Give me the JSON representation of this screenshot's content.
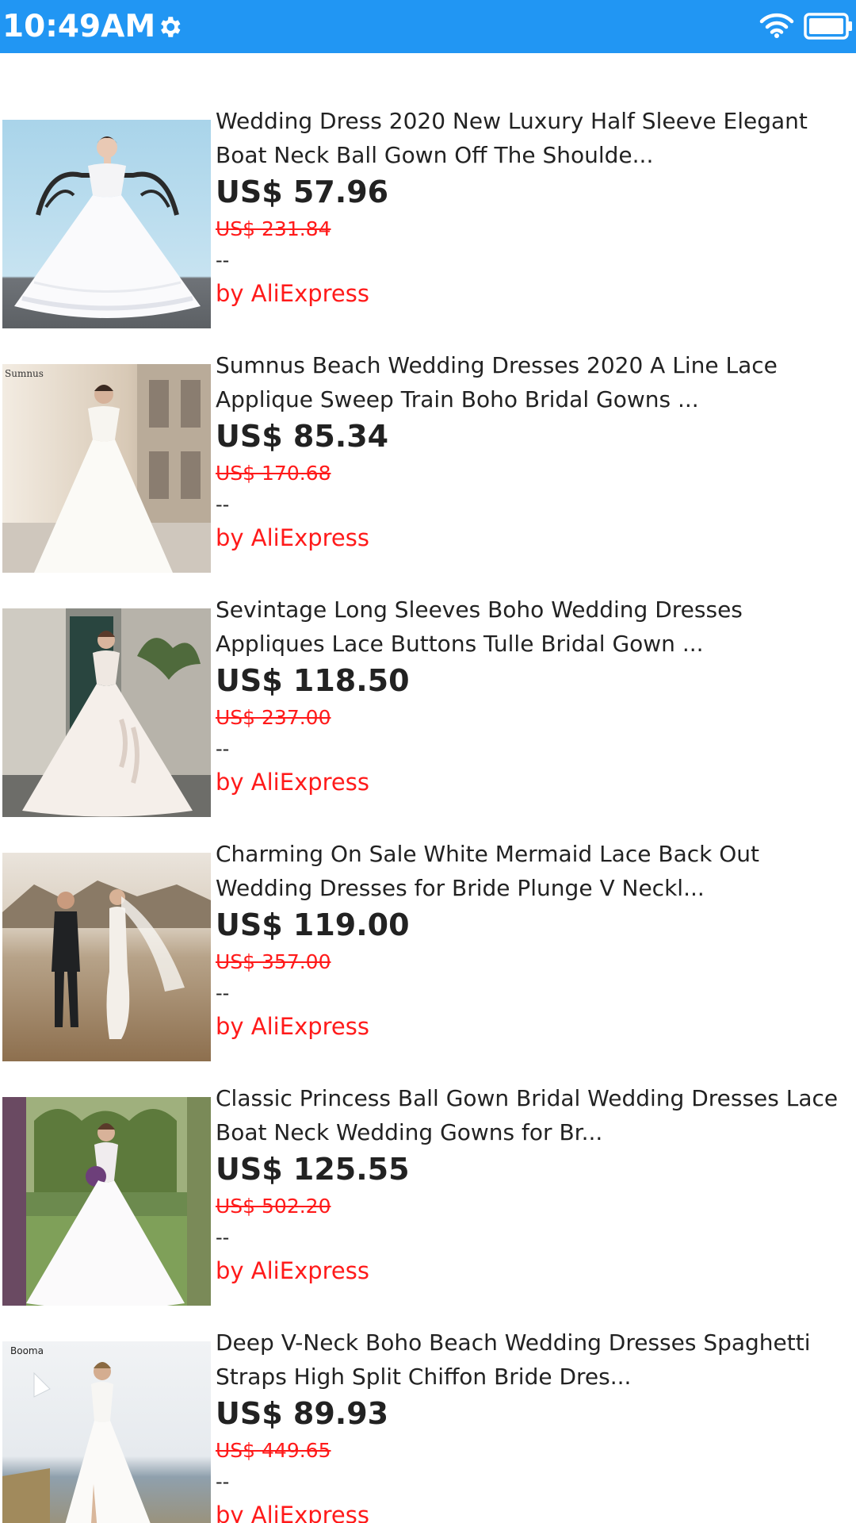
{
  "status_bar": {
    "time": "10:49AM",
    "settings_icon": "gear-icon",
    "wifi_icon": "wifi-icon",
    "battery_icon": "battery-icon",
    "color": "#2196f3"
  },
  "colors": {
    "old_price": "#ff1a1a",
    "seller": "#ff1a1a"
  },
  "products": [
    {
      "title": "Wedding Dress 2020 New Luxury Half Sleeve Elegant Boat Neck Ball Gown Off The Shoulde...",
      "price": "US$ 57.96",
      "old_price": "US$ 231.84",
      "rating": "--",
      "seller": "by AliExpress",
      "image_overlay": ""
    },
    {
      "title": "Sumnus Beach Wedding Dresses 2020 A Line Lace Applique Sweep Train Boho Bridal Gowns ...",
      "price": "US$ 85.34",
      "old_price": "US$ 170.68",
      "rating": "--",
      "seller": "by AliExpress",
      "image_overlay": "Sumnus"
    },
    {
      "title": "Sevintage Long Sleeves Boho Wedding Dresses Appliques Lace Buttons Tulle Bridal Gown ...",
      "price": "US$ 118.50",
      "old_price": "US$ 237.00",
      "rating": "--",
      "seller": "by AliExpress",
      "image_overlay": ""
    },
    {
      "title": "Charming On Sale White Mermaid Lace Back Out Wedding Dresses for Bride Plunge V Neckl...",
      "price": "US$ 119.00",
      "old_price": "US$ 357.00",
      "rating": "--",
      "seller": "by AliExpress",
      "image_overlay": ""
    },
    {
      "title": "Classic Princess Ball Gown Bridal Wedding Dresses Lace Boat Neck Wedding Gowns for Br...",
      "price": "US$ 125.55",
      "old_price": "US$ 502.20",
      "rating": "--",
      "seller": "by AliExpress",
      "image_overlay": ""
    },
    {
      "title": "Deep V-Neck Boho Beach Wedding Dresses Spaghetti Straps High Split Chiffon Bride Dres...",
      "price": "US$ 89.93",
      "old_price": "US$ 449.65",
      "rating": "--",
      "seller": "by AliExpress",
      "image_overlay": "Booma"
    }
  ]
}
